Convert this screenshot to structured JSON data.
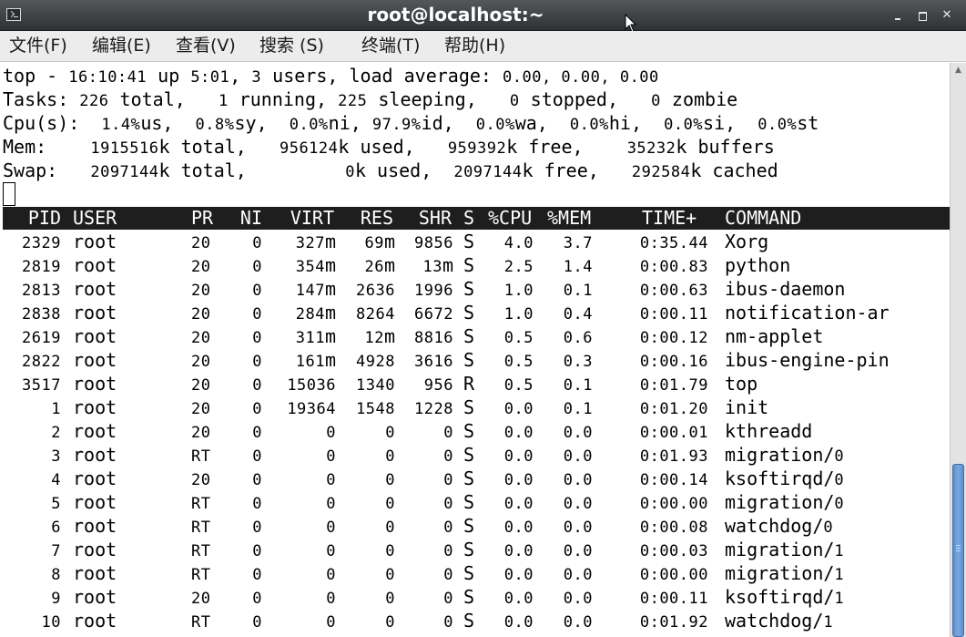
{
  "window": {
    "title": "root@localhost:~"
  },
  "menu": {
    "items": [
      "文件(F)",
      "编辑(E)",
      "查看(V)",
      "搜索 (S)",
      "终端(T)",
      "帮助(H)"
    ]
  },
  "summary": {
    "line1": {
      "label": "top - ",
      "time": "16:10:41",
      "up": " up ",
      "uptime": "5:01",
      "sep1": ", ",
      "users": "3",
      "users_label": " users, ",
      "load_label": "load average: ",
      "load": "0.00, 0.00, 0.00"
    },
    "line2": {
      "label": "Tasks: ",
      "total": "226",
      "total_label": " total, ",
      "running": "1",
      "running_label": " running, ",
      "sleeping": "225",
      "sleeping_label": " sleeping, ",
      "stopped": "0",
      "stopped_label": " stopped, ",
      "zombie": "0",
      "zombie_label": " zombie"
    },
    "line3": {
      "label": "Cpu(s): ",
      "us": "1.4%",
      "us_label": "us, ",
      "sy": "0.8%",
      "sy_label": "sy, ",
      "ni": "0.0%",
      "ni_label": "ni, ",
      "id": "97.9%",
      "id_label": "id, ",
      "wa": "0.0%",
      "wa_label": "wa, ",
      "hi": "0.0%",
      "hi_label": "hi, ",
      "si": "0.0%",
      "si_label": "si, ",
      "st": "0.0%",
      "st_label": "st"
    },
    "line4": {
      "label": "Mem: ",
      "total": "1915516",
      "total_label": "k total, ",
      "used": "956124",
      "used_label": "k used, ",
      "free": "959392",
      "free_label": "k free, ",
      "buffers": "35232",
      "buffers_label": "k buffers"
    },
    "line5": {
      "label": "Swap: ",
      "total": "2097144",
      "total_label": "k total, ",
      "used": "0",
      "used_label": "k used, ",
      "free": "2097144",
      "free_label": "k free, ",
      "cached": "292584",
      "cached_label": "k cached"
    }
  },
  "table": {
    "columns": [
      "PID",
      "USER",
      "PR",
      "NI",
      "VIRT",
      "RES",
      "SHR",
      "S",
      "%CPU",
      "%MEM",
      "TIME+",
      "COMMAND"
    ],
    "rows": [
      {
        "pid": "2329",
        "user": "root",
        "pr": "20",
        "ni": "0",
        "virt": "327",
        "virt_unit": "m",
        "res": "69",
        "res_unit": "m",
        "shr": "9856",
        "shr_unit": "",
        "s": "S",
        "cpu": "4.0",
        "mem": "3.7",
        "time": "0:35.44",
        "command": "Xorg",
        "cmd_num": ""
      },
      {
        "pid": "2819",
        "user": "root",
        "pr": "20",
        "ni": "0",
        "virt": "354",
        "virt_unit": "m",
        "res": "26",
        "res_unit": "m",
        "shr": "13",
        "shr_unit": "m",
        "s": "S",
        "cpu": "2.5",
        "mem": "1.4",
        "time": "0:00.83",
        "command": "python",
        "cmd_num": ""
      },
      {
        "pid": "2813",
        "user": "root",
        "pr": "20",
        "ni": "0",
        "virt": "147",
        "virt_unit": "m",
        "res": "2636",
        "res_unit": "",
        "shr": "1996",
        "shr_unit": "",
        "s": "S",
        "cpu": "1.0",
        "mem": "0.1",
        "time": "0:00.63",
        "command": "ibus-daemon",
        "cmd_num": ""
      },
      {
        "pid": "2838",
        "user": "root",
        "pr": "20",
        "ni": "0",
        "virt": "284",
        "virt_unit": "m",
        "res": "8264",
        "res_unit": "",
        "shr": "6672",
        "shr_unit": "",
        "s": "S",
        "cpu": "1.0",
        "mem": "0.4",
        "time": "0:00.11",
        "command": "notification-ar",
        "cmd_num": ""
      },
      {
        "pid": "2619",
        "user": "root",
        "pr": "20",
        "ni": "0",
        "virt": "311",
        "virt_unit": "m",
        "res": "12",
        "res_unit": "m",
        "shr": "8816",
        "shr_unit": "",
        "s": "S",
        "cpu": "0.5",
        "mem": "0.6",
        "time": "0:00.12",
        "command": "nm-applet",
        "cmd_num": ""
      },
      {
        "pid": "2822",
        "user": "root",
        "pr": "20",
        "ni": "0",
        "virt": "161",
        "virt_unit": "m",
        "res": "4928",
        "res_unit": "",
        "shr": "3616",
        "shr_unit": "",
        "s": "S",
        "cpu": "0.5",
        "mem": "0.3",
        "time": "0:00.16",
        "command": "ibus-engine-pin",
        "cmd_num": ""
      },
      {
        "pid": "3517",
        "user": "root",
        "pr": "20",
        "ni": "0",
        "virt": "15036",
        "virt_unit": "",
        "res": "1340",
        "res_unit": "",
        "shr": "956",
        "shr_unit": "",
        "s": "R",
        "cpu": "0.5",
        "mem": "0.1",
        "time": "0:01.79",
        "command": "top",
        "cmd_num": ""
      },
      {
        "pid": "1",
        "user": "root",
        "pr": "20",
        "ni": "0",
        "virt": "19364",
        "virt_unit": "",
        "res": "1548",
        "res_unit": "",
        "shr": "1228",
        "shr_unit": "",
        "s": "S",
        "cpu": "0.0",
        "mem": "0.1",
        "time": "0:01.20",
        "command": "init",
        "cmd_num": ""
      },
      {
        "pid": "2",
        "user": "root",
        "pr": "20",
        "ni": "0",
        "virt": "0",
        "virt_unit": "",
        "res": "0",
        "res_unit": "",
        "shr": "0",
        "shr_unit": "",
        "s": "S",
        "cpu": "0.0",
        "mem": "0.0",
        "time": "0:00.01",
        "command": "kthreadd",
        "cmd_num": ""
      },
      {
        "pid": "3",
        "user": "root",
        "pr": "RT",
        "ni": "0",
        "virt": "0",
        "virt_unit": "",
        "res": "0",
        "res_unit": "",
        "shr": "0",
        "shr_unit": "",
        "s": "S",
        "cpu": "0.0",
        "mem": "0.0",
        "time": "0:01.93",
        "command": "migration/",
        "cmd_num": "0"
      },
      {
        "pid": "4",
        "user": "root",
        "pr": "20",
        "ni": "0",
        "virt": "0",
        "virt_unit": "",
        "res": "0",
        "res_unit": "",
        "shr": "0",
        "shr_unit": "",
        "s": "S",
        "cpu": "0.0",
        "mem": "0.0",
        "time": "0:00.14",
        "command": "ksoftirqd/",
        "cmd_num": "0"
      },
      {
        "pid": "5",
        "user": "root",
        "pr": "RT",
        "ni": "0",
        "virt": "0",
        "virt_unit": "",
        "res": "0",
        "res_unit": "",
        "shr": "0",
        "shr_unit": "",
        "s": "S",
        "cpu": "0.0",
        "mem": "0.0",
        "time": "0:00.00",
        "command": "migration/",
        "cmd_num": "0"
      },
      {
        "pid": "6",
        "user": "root",
        "pr": "RT",
        "ni": "0",
        "virt": "0",
        "virt_unit": "",
        "res": "0",
        "res_unit": "",
        "shr": "0",
        "shr_unit": "",
        "s": "S",
        "cpu": "0.0",
        "mem": "0.0",
        "time": "0:00.08",
        "command": "watchdog/",
        "cmd_num": "0"
      },
      {
        "pid": "7",
        "user": "root",
        "pr": "RT",
        "ni": "0",
        "virt": "0",
        "virt_unit": "",
        "res": "0",
        "res_unit": "",
        "shr": "0",
        "shr_unit": "",
        "s": "S",
        "cpu": "0.0",
        "mem": "0.0",
        "time": "0:00.03",
        "command": "migration/",
        "cmd_num": "1"
      },
      {
        "pid": "8",
        "user": "root",
        "pr": "RT",
        "ni": "0",
        "virt": "0",
        "virt_unit": "",
        "res": "0",
        "res_unit": "",
        "shr": "0",
        "shr_unit": "",
        "s": "S",
        "cpu": "0.0",
        "mem": "0.0",
        "time": "0:00.00",
        "command": "migration/",
        "cmd_num": "1"
      },
      {
        "pid": "9",
        "user": "root",
        "pr": "20",
        "ni": "0",
        "virt": "0",
        "virt_unit": "",
        "res": "0",
        "res_unit": "",
        "shr": "0",
        "shr_unit": "",
        "s": "S",
        "cpu": "0.0",
        "mem": "0.0",
        "time": "0:00.11",
        "command": "ksoftirqd/",
        "cmd_num": "1"
      },
      {
        "pid": "10",
        "user": "root",
        "pr": "RT",
        "ni": "0",
        "virt": "0",
        "virt_unit": "",
        "res": "0",
        "res_unit": "",
        "shr": "0",
        "shr_unit": "",
        "s": "S",
        "cpu": "0.0",
        "mem": "0.0",
        "time": "0:01.92",
        "command": "watchdog/",
        "cmd_num": "1"
      }
    ]
  },
  "icons": {
    "app": "terminal-icon",
    "minimize": "minimize-icon",
    "maximize": "maximize-icon",
    "close": "close-icon",
    "cursor": "mouse-pointer-icon"
  },
  "colors": {
    "titlebar": "#3f4144",
    "header_bg": "#1e1e1e",
    "scroll_thumb": "#6c9bd8"
  }
}
